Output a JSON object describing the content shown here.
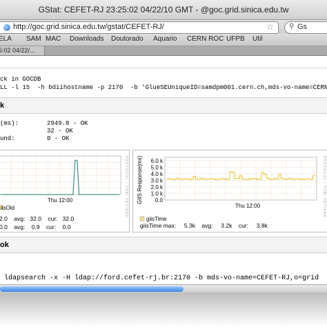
{
  "window": {
    "title": "GStat: CEFET-RJ 23:25:02 04/22/10 GMT - @goc.grid.sinica.edu.tw"
  },
  "urlbar": {
    "url": "http://goc.grid.sinica.edu.tw/gstat/CEFET-RJ/",
    "search_text": "Gs"
  },
  "bookmarks": [
    "ELA",
    "SAM",
    "MAC",
    "Downloads",
    "Doutorado",
    "Aquario",
    "CERN ROC",
    "UFPB",
    "Util"
  ],
  "tab": {
    "label": "5:02 04/22/..."
  },
  "content": {
    "lines_top": [
      "ck in GOCDB",
      "LL -l 15  -h bdiihostname -p 2170  -b 'GlueSEUniqueID=samdpm001.cern.ch,mds-vo-name=CERN-PROD"
    ],
    "section1_title": "k",
    "metrics": [
      {
        "label": "(ms):",
        "value": "2949.8 - OK"
      },
      {
        "label": "",
        "value": "32 - OK"
      },
      {
        "label": "und:",
        "value": "0 - OK"
      }
    ],
    "left_chart": {
      "x_label": "Thu 12:00",
      "legend": "iisOld",
      "stats_line1": "2.0    avg:   32.0    cur:   32.0",
      "stats_line2": "0.0    avg:    0.9    cur:    0.0"
    },
    "right_chart": {
      "side_label": "PROTOCOL / TOBI OETIKER",
      "legend": "giisTime",
      "stats": "giisTime max:     5.3k    avg:     3.2k    cur:     3.8k"
    },
    "section2_title": "ok",
    "command": " ldapsearch -x -H ldap://ford.cefet-rj.br:2170 -b mds-vo-name=CEFET-RJ,o=grid"
  },
  "chart_data": [
    {
      "type": "line",
      "title": "",
      "xlabel": "",
      "ylabel": "",
      "x_ticks": [
        "Thu 12:00"
      ],
      "series": [
        {
          "name": "iisOld",
          "values": [
            0,
            0,
            0,
            0,
            0,
            0,
            0,
            0,
            0,
            0,
            0,
            0,
            0,
            0,
            0,
            0,
            0,
            0,
            0,
            0,
            0,
            0,
            0,
            0,
            0,
            0,
            0,
            0,
            0,
            0,
            0,
            0,
            0,
            0,
            0,
            0,
            0,
            32,
            32,
            0,
            0,
            0,
            0,
            0,
            0,
            0,
            0,
            0,
            0,
            0,
            0,
            0,
            0,
            0,
            0,
            0,
            0,
            0,
            0,
            0
          ]
        }
      ],
      "grid": true
    },
    {
      "type": "line",
      "title": "",
      "xlabel": "",
      "ylabel": "GIIS Response(ms)",
      "y_ticks": [
        "0.0",
        "1.0 k",
        "2.0 k",
        "3.0 k",
        "4.0 k",
        "5.0 k",
        "6.0 k"
      ],
      "x_ticks": [
        "Thu 12:00"
      ],
      "ylim": [
        0,
        6500
      ],
      "series": [
        {
          "name": "giisTime",
          "values": [
            3200,
            3250,
            3100,
            3150,
            3300,
            3200,
            3150,
            3250,
            3200,
            3100,
            3150,
            3600,
            3200,
            3150,
            3300,
            3200,
            3150,
            3200,
            3250,
            3200,
            3100,
            3150,
            3200,
            3250,
            3150,
            3200,
            4300,
            4200,
            3250,
            3300,
            3700,
            3200,
            3150,
            3100,
            3250,
            3200,
            3300,
            3150,
            3200,
            4200,
            3900,
            3300,
            3200,
            3150,
            3300,
            3200,
            3900,
            3250,
            3200,
            3150,
            3300,
            3200,
            3150,
            3250,
            3200,
            3100,
            3150,
            3250,
            3200,
            3150,
            3700
          ]
        }
      ],
      "grid": true
    }
  ]
}
